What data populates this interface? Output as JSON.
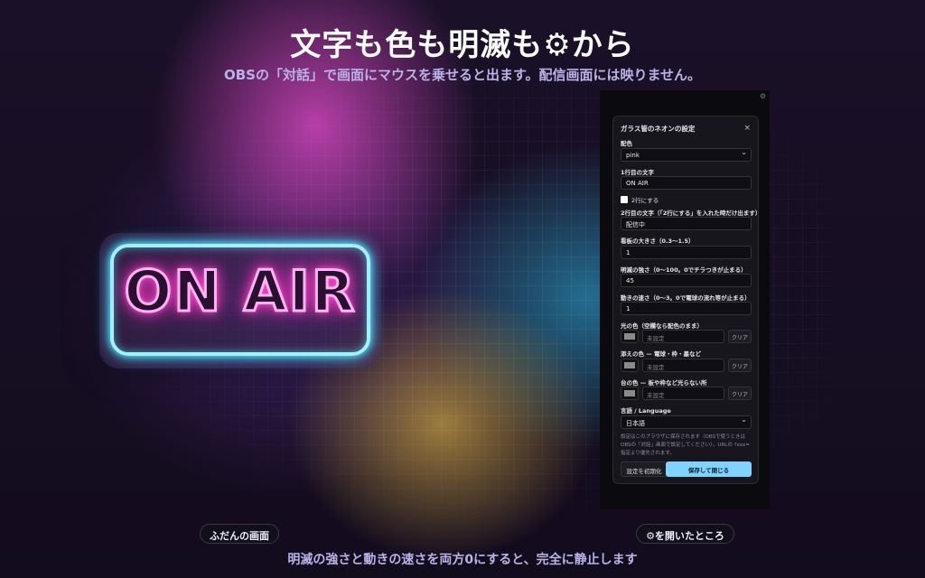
{
  "header": {
    "title": "文字も色も明滅も⚙から",
    "subtitle": "OBSの「対話」で画面にマウスを乗せると出ます。配信画面には映りません。"
  },
  "sign": {
    "text": "ON AIR",
    "frame_color": "#9ef3ff",
    "text_color": "#ff5fd6"
  },
  "panel": {
    "title": "ガラス管のネオンの設定",
    "close_icon": "close-icon",
    "color_label": "配色",
    "color_value": "pink",
    "line1_label": "1行目の文字",
    "line1_value": "ON AIR",
    "two_lines_label": "2行にする",
    "line2_label": "2行目の文字（「2行にする」を入れた時だけ出ます）",
    "line2_value": "配信中",
    "size_label": "看板の大きさ（0.3〜1.5）",
    "size_value": "1",
    "blink_label": "明滅の強さ（0〜100。0でチラつきが止まる）",
    "blink_value": "45",
    "speed_label": "動きの速さ（0〜3。0で電球の流れ等が止まる）",
    "speed_value": "1",
    "light_color_label": "光の色（空欄なら配色のまま）",
    "light_color_placeholder": "未設定",
    "accent_color_label": "添えの色 — 電球・枠・墨など",
    "accent_color_placeholder": "未設定",
    "base_color_label": "台の色 — 板や枠など光らない所",
    "base_color_placeholder": "未設定",
    "clear_label": "クリア",
    "language_label": "言語 / Language",
    "language_value": "日本語",
    "note": "設定はこのブラウザに保存されます（OBSで使うときはOBSの「対話」画面で設定してください）。URLの ?xxx= 指定より優先されます。",
    "reset_label": "設定を初期化",
    "save_label": "保存して閉じる",
    "save_color": "#7fd3ff"
  },
  "captions": {
    "normal": "ふだんの画面",
    "opened": "⚙を開いたところ"
  },
  "footer": "明滅の強さと動きの速さを両方0にすると、完全に静止します"
}
